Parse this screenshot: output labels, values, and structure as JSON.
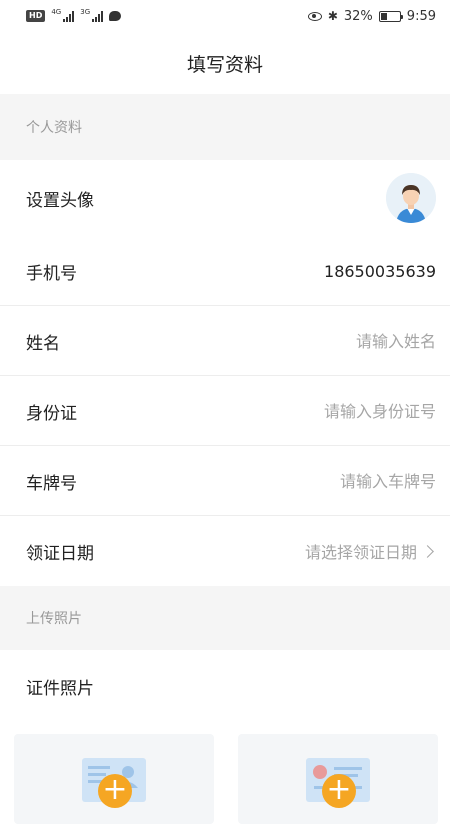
{
  "status_bar": {
    "badge": "HD",
    "net1": "4G",
    "net2": "3G",
    "battery_percent": "32%",
    "battery_level": 0.32,
    "time": "9:59"
  },
  "nav": {
    "title": "填写资料"
  },
  "sections": {
    "personal": "个人资料",
    "photos": "上传照片"
  },
  "rows": {
    "avatar": {
      "label": "设置头像"
    },
    "phone": {
      "label": "手机号",
      "value": "18650035639"
    },
    "name": {
      "label": "姓名",
      "placeholder": "请输入姓名",
      "value": ""
    },
    "id_card": {
      "label": "身份证",
      "placeholder": "请输入身份证号",
      "value": ""
    },
    "plate": {
      "label": "车牌号",
      "placeholder": "请输入车牌号",
      "value": ""
    },
    "license_date": {
      "label": "领证日期",
      "placeholder": "请选择领证日期"
    },
    "id_photo": {
      "label": "证件照片"
    }
  },
  "icons": {
    "chevron": "chevron-right-icon",
    "add": "add-icon",
    "avatar": "avatar-placeholder-icon"
  },
  "colors": {
    "accent": "#f5a623",
    "section_bg": "#f5f5f5",
    "placeholder": "#a6a6a6"
  }
}
